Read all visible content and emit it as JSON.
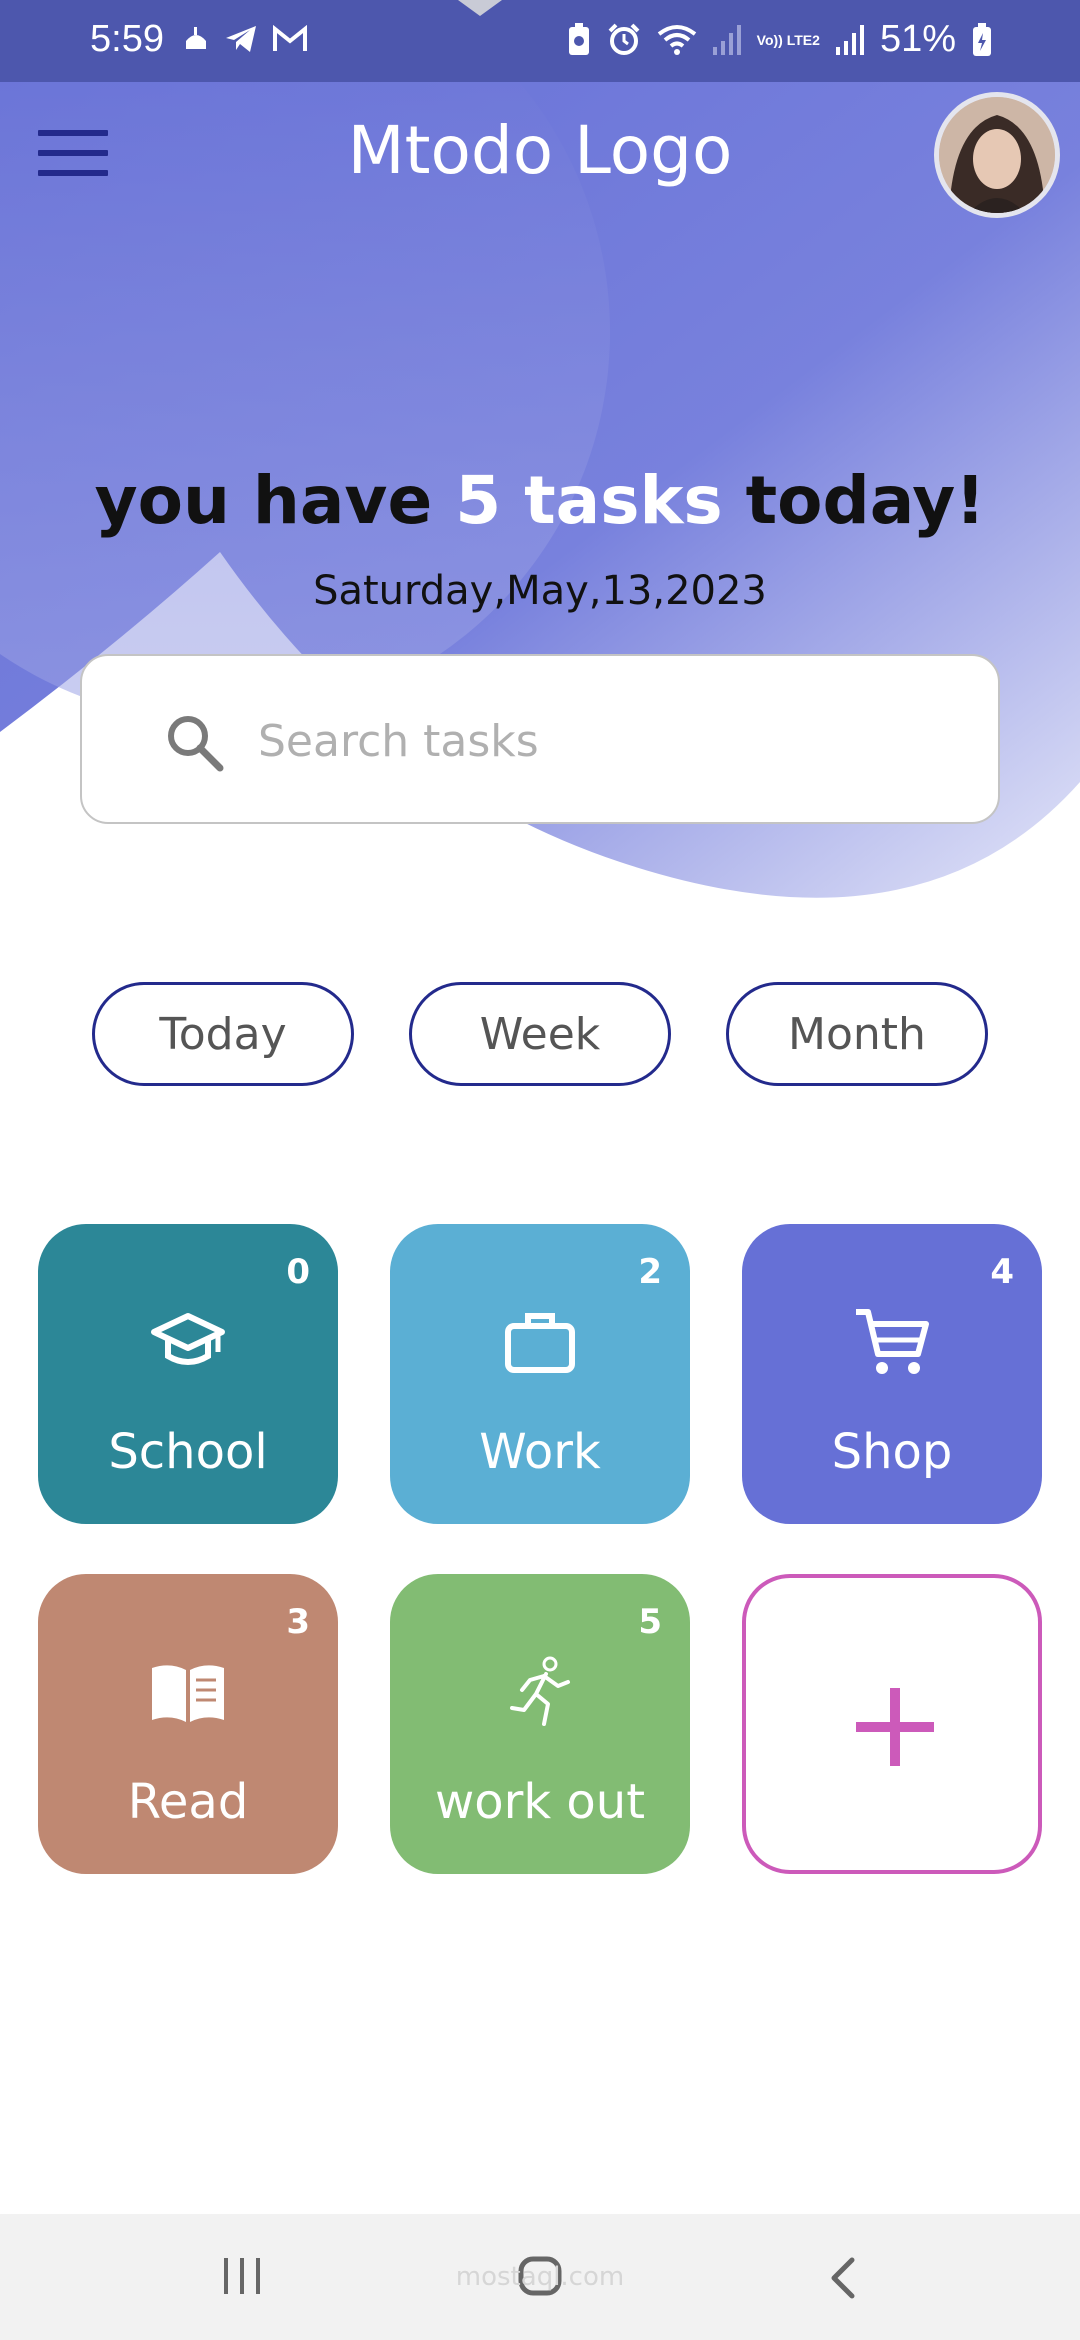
{
  "status_bar": {
    "time": "5:59",
    "battery": "51%",
    "network_label": "Vo)) LTE2"
  },
  "header": {
    "title": "Mtodo Logo",
    "menu_icon": "hamburger-menu-icon",
    "avatar_icon": "user-avatar"
  },
  "summary": {
    "prefix": "you have ",
    "count_text": "5 tasks",
    "suffix": " today!",
    "date": "Saturday,May,13,2023"
  },
  "search": {
    "placeholder": "Search tasks",
    "value": ""
  },
  "filters": [
    {
      "label": "Today"
    },
    {
      "label": "Week"
    },
    {
      "label": "Month"
    }
  ],
  "categories": [
    {
      "label": "School",
      "count": "0",
      "icon": "graduation-cap-icon",
      "color": "#2c8797"
    },
    {
      "label": "Work",
      "count": "2",
      "icon": "briefcase-icon",
      "color": "#5bafd4"
    },
    {
      "label": "Shop",
      "count": "4",
      "icon": "shopping-cart-icon",
      "color": "#6670d6"
    },
    {
      "label": "Read",
      "count": "3",
      "icon": "open-book-icon",
      "color": "#bf8872"
    },
    {
      "label": "work out",
      "count": "5",
      "icon": "running-person-icon",
      "color": "#82bc73"
    }
  ],
  "add_category": {
    "icon": "plus-icon",
    "color": "#cc5aba"
  },
  "nav": {
    "recents": "recent-apps-icon",
    "home": "home-icon",
    "back": "back-icon"
  },
  "watermark": "mostaql.com",
  "colors": {
    "status_bar": "#4d57ad",
    "hero": "#6670d6",
    "accent_dark": "#232a8c"
  }
}
